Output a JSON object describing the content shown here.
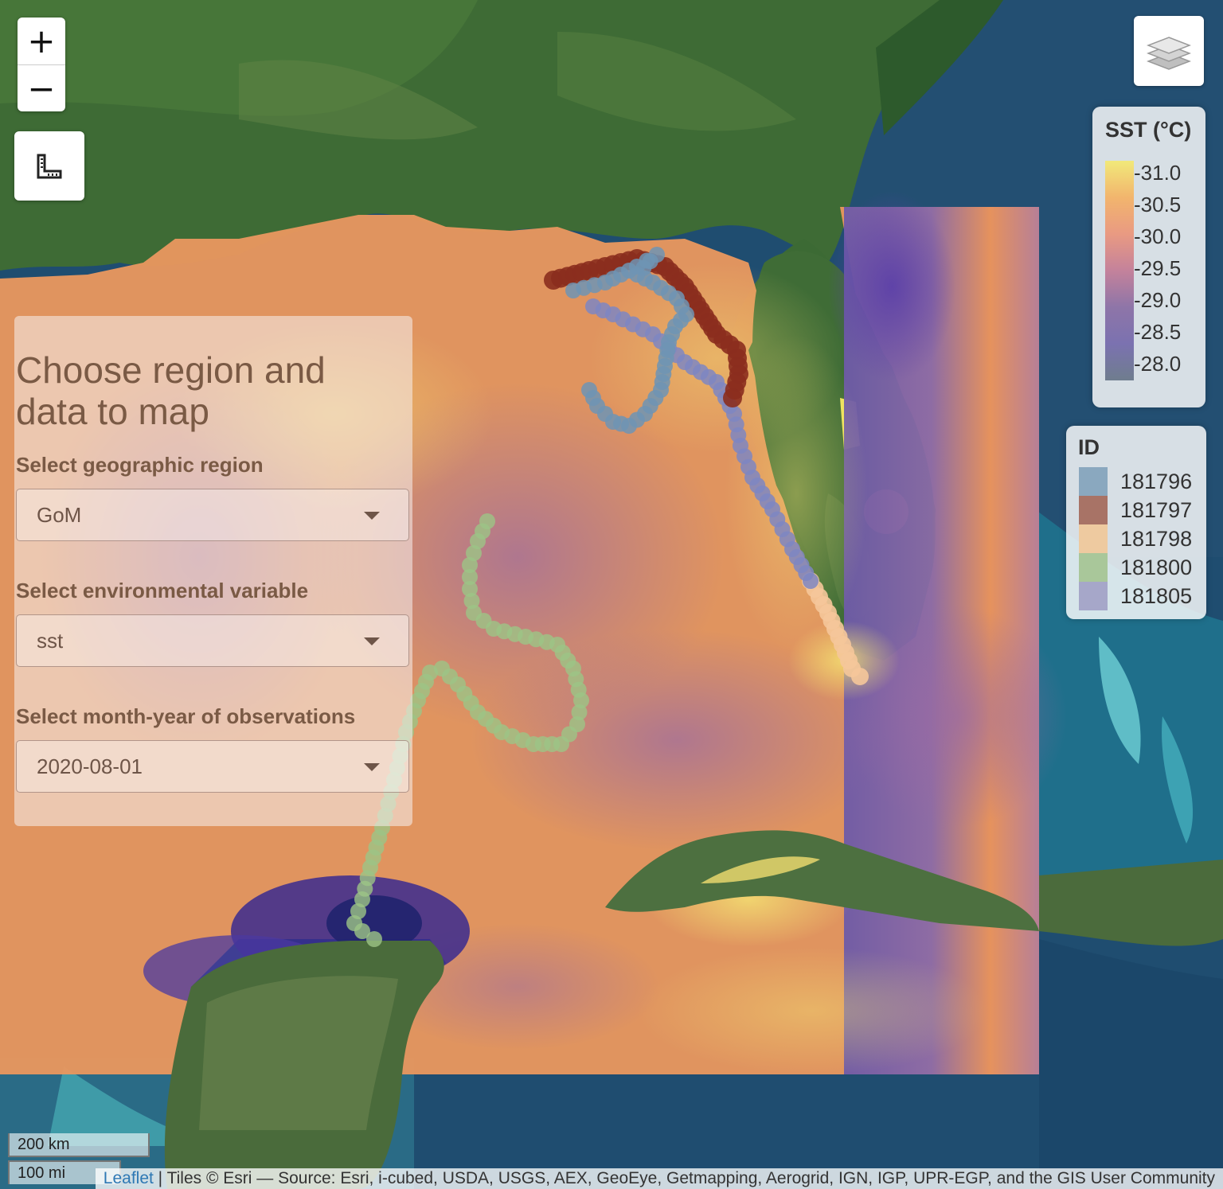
{
  "map": {
    "controls": {
      "zoom_in": "+",
      "zoom_out": "−",
      "measure_icon": "measure-ruler-icon",
      "layers_icon": "layers-stack-icon"
    },
    "legend_sst": {
      "title": "SST (°C)",
      "ticks": [
        "31.0",
        "30.5",
        "30.0",
        "29.5",
        "29.0",
        "28.5",
        "28.0"
      ],
      "colors": [
        "#f1e97a",
        "#f2b56d",
        "#e99a82",
        "#c4829b",
        "#8e75a8",
        "#7b72b0",
        "#6f7d8e"
      ]
    },
    "legend_id": {
      "title": "ID",
      "items": [
        {
          "label": "181796",
          "color": "#8aa8bf"
        },
        {
          "label": "181797",
          "color": "#a87366"
        },
        {
          "label": "181798",
          "color": "#eecaa0"
        },
        {
          "label": "181800",
          "color": "#a9c79a"
        },
        {
          "label": "181805",
          "color": "#a6a7c9"
        }
      ]
    },
    "scale": {
      "km": "200 km",
      "mi": "100 mi"
    },
    "attribution": {
      "leaflet": "Leaflet",
      "text": " | Tiles © Esri — Source: Esri, i-cubed, USDA, USGS, AEX, GeoEye, Getmapping, Aerogrid, IGN, IGP, UPR-EGP, and the GIS User Community"
    },
    "track_colors": {
      "181796": "#6f94b4",
      "181797": "#8b2e1e",
      "181798": "#f5c79a",
      "181800": "#9cc486",
      "181805": "#7e86c2"
    }
  },
  "panel": {
    "title": "Choose region and data to map",
    "region_label": "Select geographic region",
    "region_value": "GoM",
    "variable_label": "Select environmental variable",
    "variable_value": "sst",
    "month_label": "Select month-year of observations",
    "month_value": "2020-08-01"
  }
}
